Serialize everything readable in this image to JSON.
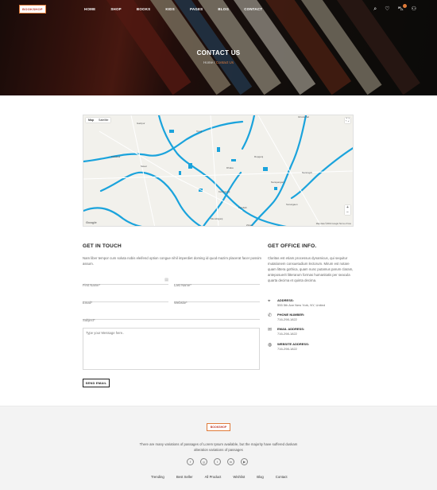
{
  "brand": {
    "logo_text": "BOOKSHOP"
  },
  "nav": {
    "items": [
      "HOME",
      "SHOP",
      "BOOKS",
      "KIDS",
      "PAGES",
      "BLOG",
      "CONTACT"
    ],
    "icons": [
      "search-icon",
      "heart-icon",
      "cart-icon",
      "user-icon"
    ]
  },
  "hero": {
    "title": "CONTACT US",
    "breadcrumb_home": "Home",
    "breadcrumb_sep": "/",
    "breadcrumb_current": "Contact Us"
  },
  "map": {
    "toggle_map": "Map",
    "toggle_satellite": "Satellite",
    "attribution": "Map data ©2019 Google   Terms of Use",
    "google": "Google",
    "labels": [
      "Tongi",
      "Savar",
      "Dhaka",
      "Keraniganj",
      "Narayanganj",
      "Zirani",
      "Kaliakair",
      "Ghorashal",
      "Narsingdi",
      "Rupganj",
      "Sonargaon",
      "Fatullah",
      "Munshiganj",
      "Gazipur"
    ]
  },
  "contact": {
    "title": "GET IN TOUCH",
    "intro": "Nam liber tempor cum soluta nobis eleifend option congue nihil imperdiet doming id quod mazim placerat facer possim assum.",
    "first_name": "First Name*",
    "last_name": "Last Name*",
    "email": "Email*",
    "website": "Website*",
    "subject": "Subject*",
    "message": "Type your Message here..",
    "send": "SEND EMAIL"
  },
  "office": {
    "title": "GET OFFICE INFO.",
    "intro": "Claritas est etiam processus dynamicus, qui sequitur mutationem consuetudium lectorum. Mirum est notare quam littera gothica, quam nunc putamus parum claram, anteposuerit litterarum formas humanitatis per seacula quarta decima et quinta decima.",
    "rows": [
      {
        "icon": "location-icon",
        "head": "ADDRESS:",
        "value": "555 5th Ave New York, NY, United"
      },
      {
        "icon": "phone-icon",
        "head": "PHONE NUMBER:",
        "value": "716-298-1822"
      },
      {
        "icon": "mail-icon",
        "head": "EMAIL ADDRESS:",
        "value": "716-298-1822"
      },
      {
        "icon": "globe-icon",
        "head": "WEBSITE ADDRESS:",
        "value": "716-298-1822"
      }
    ]
  },
  "footer": {
    "logo_text": "BOOKSHOP",
    "text": "There are many variations of passages of Lorem Ipsum available, but the majority have suffered duskam alteration variations of passages",
    "socials": [
      "facebook-icon",
      "google-plus-icon",
      "twitter-icon",
      "linkedin-icon",
      "youtube-icon"
    ],
    "links": [
      "Trending",
      "Best Seller",
      "All Product",
      "Wishlist",
      "Blog",
      "Contact"
    ]
  },
  "colors": {
    "accent": "#e07b39",
    "map_water": "#1aa3dc"
  }
}
